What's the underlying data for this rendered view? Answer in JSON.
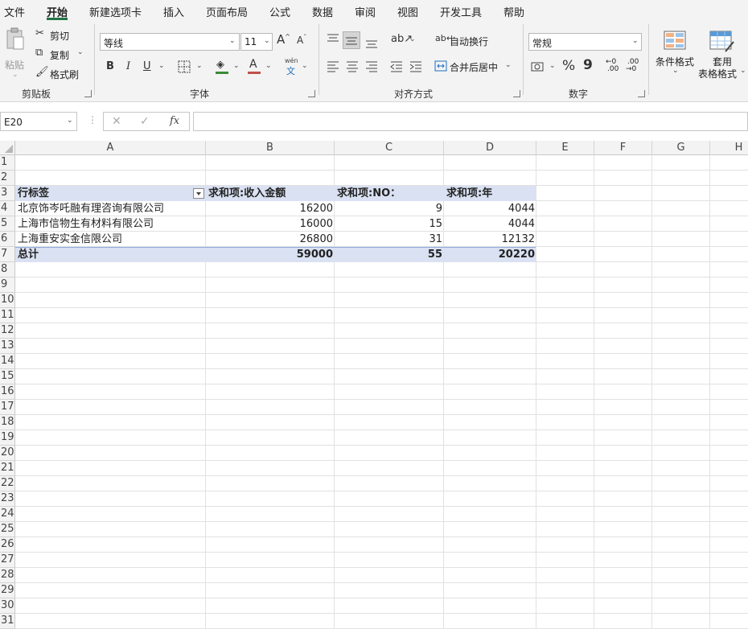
{
  "menu": {
    "tabs": [
      "文件",
      "开始",
      "新建选项卡",
      "插入",
      "页面布局",
      "公式",
      "数据",
      "审阅",
      "视图",
      "开发工具",
      "帮助"
    ],
    "active": "开始"
  },
  "ribbon": {
    "clipboard": {
      "paste": "粘贴",
      "cut": "剪切",
      "copy": "复制",
      "format_painter": "格式刷",
      "label": "剪贴板"
    },
    "font": {
      "name": "等线",
      "size": "11",
      "label": "字体",
      "bold": "B",
      "italic": "I",
      "underline": "U",
      "grow": "A",
      "shrink": "A",
      "phonetic_top": "wén",
      "phonetic_bottom": "文"
    },
    "alignment": {
      "wrap": "自动换行",
      "merge": "合并后居中",
      "label": "对齐方式"
    },
    "number": {
      "format": "常规",
      "percent": "%",
      "comma": "9",
      "inc_decimal": ".00",
      "dec_decimal": ".00",
      "label": "数字"
    },
    "styles": {
      "conditional": "条件格式",
      "table_format_1": "套用",
      "table_format_2": "表格格式"
    }
  },
  "formula_bar": {
    "name_box": "E20",
    "formula": "",
    "fx": "fx"
  },
  "columns": [
    "A",
    "B",
    "C",
    "D",
    "E",
    "F",
    "G",
    "H"
  ],
  "rows": [
    "1",
    "2",
    "3",
    "4",
    "5",
    "6",
    "7",
    "8",
    "9",
    "10",
    "11",
    "12",
    "13",
    "14",
    "15",
    "16",
    "17",
    "18",
    "19",
    "20",
    "21",
    "22",
    "23",
    "24",
    "25",
    "26",
    "27",
    "28",
    "29",
    "30",
    "31"
  ],
  "pivot": {
    "headers": [
      "行标签",
      "求和项:收入金额",
      "求和项:NO：",
      "求和项:年"
    ],
    "rows": [
      {
        "label": "北京饰岑吒融有理咨询有限公司",
        "b": "16200",
        "c": "9",
        "d": "4044"
      },
      {
        "label": "上海市信物生有材料有限公司",
        "b": "16000",
        "c": "15",
        "d": "4044"
      },
      {
        "label": "上海重安实金信限公司",
        "b": "26800",
        "c": "31",
        "d": "12132"
      }
    ],
    "total": {
      "label": "总计",
      "b": "59000",
      "c": "55",
      "d": "20220"
    }
  }
}
